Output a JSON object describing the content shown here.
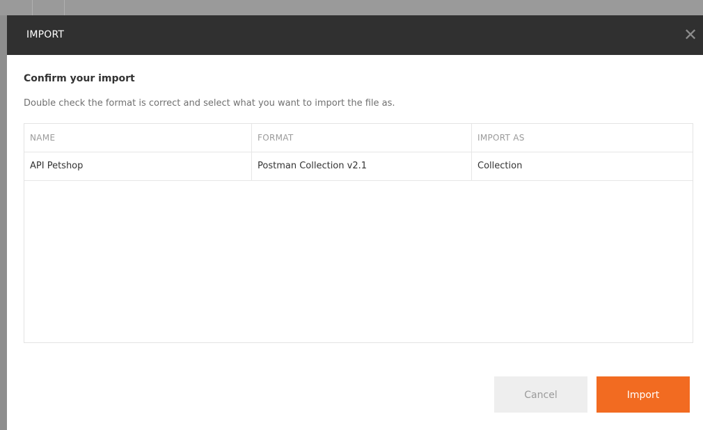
{
  "dialog": {
    "title": "IMPORT",
    "close_symbol": "✕",
    "heading": "Confirm your import",
    "description": "Double check the format is correct and select what you want to import the file as."
  },
  "table": {
    "columns": [
      "NAME",
      "FORMAT",
      "IMPORT AS"
    ],
    "rows": [
      {
        "name": "API Petshop",
        "format": "Postman Collection v2.1",
        "import_as": "Collection"
      }
    ]
  },
  "buttons": {
    "cancel": "Cancel",
    "import": "Import"
  },
  "colors": {
    "header_bg": "#303030",
    "accent": "#f26b21"
  },
  "icons": {
    "close": "close-icon"
  }
}
